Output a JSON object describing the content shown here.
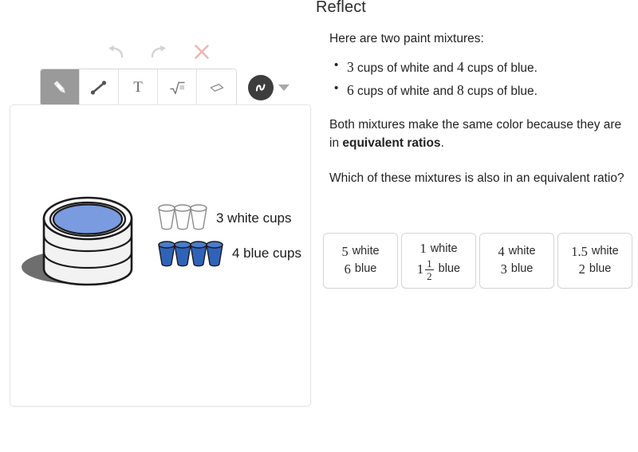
{
  "whiteboard": {
    "history": [
      {
        "name": "undo-button",
        "icon": "undo-icon",
        "label": "Undo"
      },
      {
        "name": "redo-button",
        "icon": "redo-icon",
        "label": "Redo"
      },
      {
        "name": "clear-button",
        "icon": "close-x-icon",
        "label": "Clear"
      }
    ],
    "tools": [
      {
        "name": "pencil-tool",
        "icon": "pencil-icon",
        "label": "Pencil",
        "selected": true
      },
      {
        "name": "line-tool",
        "icon": "line-icon",
        "label": "Line",
        "selected": false
      },
      {
        "name": "text-tool",
        "icon": "text-t-icon",
        "label": "T",
        "selected": false
      },
      {
        "name": "math-tool",
        "icon": "square-root-icon",
        "label": "√",
        "selected": false
      },
      {
        "name": "eraser-tool",
        "icon": "eraser-icon",
        "label": "Eraser",
        "selected": false
      }
    ],
    "stroke_control": {
      "name": "stroke-style-button",
      "icon": "squiggle-stroke-icon",
      "caret": "chevron-down-icon",
      "color": "#3d3d3d"
    },
    "canvas": {
      "name": "drawing-canvas",
      "illustration": {
        "white_cups_label": "3 white cups",
        "blue_cups_label": "4 blue cups",
        "white_cup_count": 3,
        "blue_cup_count": 4,
        "can_lid_color": "#7b9be0",
        "can_body_color": "#f0f0f0",
        "cup_blue_color": "#2f63b8",
        "shadow_color": "#6e6e6e"
      }
    }
  },
  "problem": {
    "title": "Reflect",
    "intro": "Here are two paint mixtures:",
    "mixtures": [
      {
        "white": "3",
        "blue": "4",
        "mid": " cups of white and ",
        "end": " cups of blue."
      },
      {
        "white": "6",
        "blue": "8",
        "mid": " cups of white and ",
        "end": " cups of blue."
      }
    ],
    "statement_part1": "Both mixtures make the same color because they are in ",
    "statement_bold": "equivalent ratios",
    "statement_part2": ".",
    "question": "Which of these mixtures is also in an equivalent ratio?",
    "choices": [
      {
        "name": "choice-5-white-6-blue",
        "top_value": "5",
        "top_label": "white",
        "bottom_value": "6",
        "bottom_label": "blue",
        "bottom_is_fraction": false
      },
      {
        "name": "choice-1-white-1-and-a-half-blue",
        "top_value": "1",
        "top_label": "white",
        "bottom_value": "1",
        "bottom_label": "blue",
        "bottom_is_fraction": true,
        "bottom_frac_num": "1",
        "bottom_frac_den": "2"
      },
      {
        "name": "choice-4-white-3-blue",
        "top_value": "4",
        "top_label": "white",
        "bottom_value": "3",
        "bottom_label": "blue",
        "bottom_is_fraction": false
      },
      {
        "name": "choice-1point5-white-2-blue",
        "top_value": "1.5",
        "top_label": "white",
        "bottom_value": "2",
        "bottom_label": "blue",
        "bottom_is_fraction": false
      }
    ]
  }
}
